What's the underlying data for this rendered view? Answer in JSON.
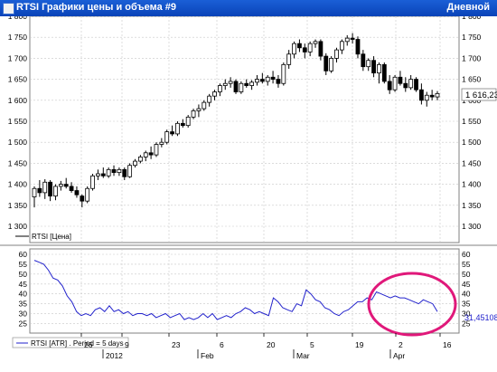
{
  "window": {
    "title": "RTSI Графики цены и объема #9",
    "interval_label": "Дневной"
  },
  "colors": {
    "titlebar": "#0a43b8",
    "candle_up": "#ffffff",
    "candle_down": "#000000",
    "atr_line": "#2222cc",
    "highlight_circle": "#e0187a",
    "grid": "#c8c8c8"
  },
  "chart_data": [
    {
      "type": "candlestick",
      "title": "",
      "legend": "RTSI [Цена]",
      "last_value_label": "1 616,23",
      "y_ticks": [
        "1 300",
        "1 350",
        "1 400",
        "1 450",
        "1 500",
        "1 550",
        "1 600",
        "1 650",
        "1 700",
        "1 750",
        "1 800"
      ],
      "ylim": [
        1300,
        1800
      ],
      "grid": true,
      "candles": [
        {
          "o": 1370,
          "h": 1395,
          "l": 1345,
          "c": 1390
        },
        {
          "o": 1390,
          "h": 1410,
          "l": 1370,
          "c": 1380
        },
        {
          "o": 1380,
          "h": 1412,
          "l": 1365,
          "c": 1405
        },
        {
          "o": 1405,
          "h": 1410,
          "l": 1360,
          "c": 1372
        },
        {
          "o": 1372,
          "h": 1400,
          "l": 1362,
          "c": 1395
        },
        {
          "o": 1395,
          "h": 1408,
          "l": 1385,
          "c": 1400
        },
        {
          "o": 1400,
          "h": 1415,
          "l": 1390,
          "c": 1395
        },
        {
          "o": 1395,
          "h": 1405,
          "l": 1380,
          "c": 1385
        },
        {
          "o": 1385,
          "h": 1395,
          "l": 1368,
          "c": 1375
        },
        {
          "o": 1372,
          "h": 1376,
          "l": 1345,
          "c": 1360
        },
        {
          "o": 1360,
          "h": 1395,
          "l": 1355,
          "c": 1390
        },
        {
          "o": 1390,
          "h": 1425,
          "l": 1385,
          "c": 1420
        },
        {
          "o": 1420,
          "h": 1435,
          "l": 1410,
          "c": 1425
        },
        {
          "o": 1425,
          "h": 1440,
          "l": 1415,
          "c": 1420
        },
        {
          "o": 1420,
          "h": 1440,
          "l": 1415,
          "c": 1435
        },
        {
          "o": 1435,
          "h": 1445,
          "l": 1420,
          "c": 1428
        },
        {
          "o": 1428,
          "h": 1440,
          "l": 1420,
          "c": 1435
        },
        {
          "o": 1435,
          "h": 1440,
          "l": 1410,
          "c": 1418
        },
        {
          "o": 1418,
          "h": 1450,
          "l": 1415,
          "c": 1445
        },
        {
          "o": 1445,
          "h": 1460,
          "l": 1440,
          "c": 1455
        },
        {
          "o": 1455,
          "h": 1470,
          "l": 1450,
          "c": 1465
        },
        {
          "o": 1465,
          "h": 1480,
          "l": 1455,
          "c": 1475
        },
        {
          "o": 1475,
          "h": 1490,
          "l": 1460,
          "c": 1470
        },
        {
          "o": 1470,
          "h": 1500,
          "l": 1465,
          "c": 1495
        },
        {
          "o": 1495,
          "h": 1510,
          "l": 1488,
          "c": 1500
        },
        {
          "o": 1500,
          "h": 1530,
          "l": 1495,
          "c": 1525
        },
        {
          "o": 1525,
          "h": 1540,
          "l": 1515,
          "c": 1520
        },
        {
          "o": 1520,
          "h": 1550,
          "l": 1515,
          "c": 1545
        },
        {
          "o": 1545,
          "h": 1555,
          "l": 1535,
          "c": 1540
        },
        {
          "o": 1540,
          "h": 1565,
          "l": 1535,
          "c": 1560
        },
        {
          "o": 1560,
          "h": 1580,
          "l": 1555,
          "c": 1575
        },
        {
          "o": 1575,
          "h": 1590,
          "l": 1560,
          "c": 1580
        },
        {
          "o": 1580,
          "h": 1600,
          "l": 1575,
          "c": 1595
        },
        {
          "o": 1595,
          "h": 1615,
          "l": 1585,
          "c": 1610
        },
        {
          "o": 1610,
          "h": 1625,
          "l": 1600,
          "c": 1620
        },
        {
          "o": 1620,
          "h": 1640,
          "l": 1610,
          "c": 1635
        },
        {
          "o": 1635,
          "h": 1650,
          "l": 1625,
          "c": 1640
        },
        {
          "o": 1640,
          "h": 1655,
          "l": 1630,
          "c": 1645
        },
        {
          "o": 1645,
          "h": 1650,
          "l": 1615,
          "c": 1620
        },
        {
          "o": 1620,
          "h": 1645,
          "l": 1615,
          "c": 1640
        },
        {
          "o": 1640,
          "h": 1650,
          "l": 1630,
          "c": 1635
        },
        {
          "o": 1635,
          "h": 1648,
          "l": 1625,
          "c": 1643
        },
        {
          "o": 1643,
          "h": 1660,
          "l": 1635,
          "c": 1650
        },
        {
          "o": 1650,
          "h": 1665,
          "l": 1640,
          "c": 1645
        },
        {
          "o": 1645,
          "h": 1660,
          "l": 1635,
          "c": 1655
        },
        {
          "o": 1655,
          "h": 1670,
          "l": 1640,
          "c": 1650
        },
        {
          "o": 1650,
          "h": 1660,
          "l": 1630,
          "c": 1640
        },
        {
          "o": 1640,
          "h": 1690,
          "l": 1635,
          "c": 1685
        },
        {
          "o": 1685,
          "h": 1720,
          "l": 1675,
          "c": 1710
        },
        {
          "o": 1710,
          "h": 1740,
          "l": 1700,
          "c": 1735
        },
        {
          "o": 1735,
          "h": 1745,
          "l": 1715,
          "c": 1725
        },
        {
          "o": 1725,
          "h": 1735,
          "l": 1700,
          "c": 1715
        },
        {
          "o": 1715,
          "h": 1740,
          "l": 1705,
          "c": 1735
        },
        {
          "o": 1735,
          "h": 1745,
          "l": 1725,
          "c": 1740
        },
        {
          "o": 1740,
          "h": 1745,
          "l": 1695,
          "c": 1705
        },
        {
          "o": 1705,
          "h": 1712,
          "l": 1660,
          "c": 1670
        },
        {
          "o": 1670,
          "h": 1705,
          "l": 1665,
          "c": 1700
        },
        {
          "o": 1700,
          "h": 1725,
          "l": 1690,
          "c": 1720
        },
        {
          "o": 1720,
          "h": 1745,
          "l": 1710,
          "c": 1740
        },
        {
          "o": 1740,
          "h": 1755,
          "l": 1730,
          "c": 1748
        },
        {
          "o": 1748,
          "h": 1760,
          "l": 1735,
          "c": 1745
        },
        {
          "o": 1745,
          "h": 1752,
          "l": 1700,
          "c": 1710
        },
        {
          "o": 1710,
          "h": 1720,
          "l": 1670,
          "c": 1680
        },
        {
          "o": 1680,
          "h": 1700,
          "l": 1670,
          "c": 1695
        },
        {
          "o": 1695,
          "h": 1705,
          "l": 1655,
          "c": 1665
        },
        {
          "o": 1665,
          "h": 1690,
          "l": 1640,
          "c": 1685
        },
        {
          "o": 1685,
          "h": 1690,
          "l": 1640,
          "c": 1645
        },
        {
          "o": 1645,
          "h": 1660,
          "l": 1615,
          "c": 1625
        },
        {
          "o": 1625,
          "h": 1660,
          "l": 1620,
          "c": 1655
        },
        {
          "o": 1655,
          "h": 1670,
          "l": 1635,
          "c": 1640
        },
        {
          "o": 1640,
          "h": 1655,
          "l": 1620,
          "c": 1630
        },
        {
          "o": 1630,
          "h": 1660,
          "l": 1625,
          "c": 1650
        },
        {
          "o": 1650,
          "h": 1655,
          "l": 1620,
          "c": 1625
        },
        {
          "o": 1625,
          "h": 1640,
          "l": 1590,
          "c": 1600
        },
        {
          "o": 1600,
          "h": 1620,
          "l": 1585,
          "c": 1612
        },
        {
          "o": 1612,
          "h": 1625,
          "l": 1600,
          "c": 1608
        },
        {
          "o": 1608,
          "h": 1622,
          "l": 1600,
          "c": 1616
        }
      ]
    },
    {
      "type": "line",
      "legend": "RTSI [ATR] . Period = 5 days",
      "last_value_label": "31,45108",
      "y_ticks": [
        "25",
        "30",
        "35",
        "40",
        "45",
        "50",
        "55",
        "60"
      ],
      "ylim": [
        22,
        60
      ],
      "values": [
        57,
        56,
        55,
        52,
        48,
        47,
        44,
        39,
        36,
        31,
        29,
        30,
        29,
        32,
        33,
        31,
        34,
        31,
        32,
        30,
        31,
        29,
        30,
        30,
        29,
        30,
        28,
        29,
        30,
        28,
        29,
        30,
        27,
        28,
        27,
        28,
        30,
        28,
        30,
        27,
        28,
        29,
        28,
        30,
        31,
        33,
        32,
        30,
        31,
        30,
        29,
        38,
        36,
        33,
        32,
        31,
        35,
        34,
        42,
        40,
        37,
        36,
        33,
        32,
        30,
        29,
        31,
        32,
        34,
        36,
        36,
        38,
        37,
        41,
        40,
        39,
        38,
        39,
        38,
        38,
        37,
        36,
        35,
        37,
        36,
        35,
        31
      ]
    }
  ],
  "x_axis": {
    "row1": [
      "26",
      "9",
      "23",
      "6",
      "20",
      "5",
      "19",
      "2",
      "16"
    ],
    "row2": [
      "2012",
      "Feb",
      "Mar",
      "Apr"
    ]
  }
}
